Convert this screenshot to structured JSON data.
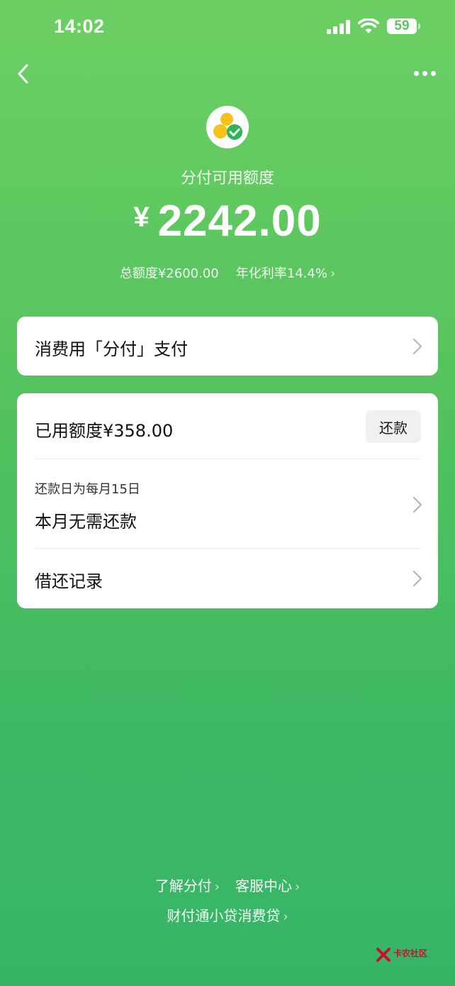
{
  "status_bar": {
    "time": "14:02",
    "battery": "59"
  },
  "header": {
    "available_label": "分付可用额度",
    "currency": "¥",
    "available_amount": "2242.00",
    "total_limit": "总额度¥2600.00",
    "annual_rate": "年化利率14.4%"
  },
  "pay_card": {
    "label": "消费用「分付」支付"
  },
  "usage_card": {
    "used_label": "已用额度¥358.00",
    "repay_button": "还款",
    "due_label": "还款日为每月15日",
    "due_status": "本月无需还款",
    "records_label": "借还记录"
  },
  "footer": {
    "learn_link": "了解分付",
    "service_link": "客服中心",
    "provider_link": "财付通小贷消费贷"
  },
  "watermark": {
    "text": "卡农社区"
  },
  "colors": {
    "bg_top": "#6ccf63",
    "bg_bottom": "#36b466",
    "logo_yellow": "#f5c21b",
    "logo_green": "#2fb457"
  }
}
